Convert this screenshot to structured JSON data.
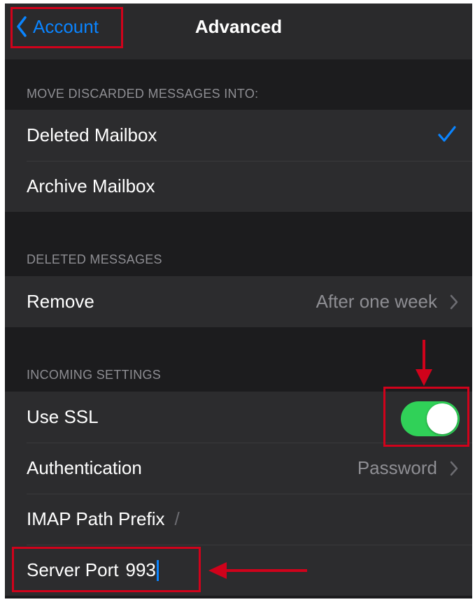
{
  "navbar": {
    "back_label": "Account",
    "title": "Advanced"
  },
  "sections": {
    "discarded": {
      "header": "MOVE DISCARDED MESSAGES INTO:",
      "items": [
        {
          "label": "Deleted Mailbox",
          "selected": true
        },
        {
          "label": "Archive Mailbox",
          "selected": false
        }
      ]
    },
    "deleted": {
      "header": "DELETED MESSAGES",
      "remove": {
        "label": "Remove",
        "value": "After one week"
      }
    },
    "incoming": {
      "header": "INCOMING SETTINGS",
      "use_ssl": {
        "label": "Use SSL",
        "on": true
      },
      "authentication": {
        "label": "Authentication",
        "value": "Password"
      },
      "imap_prefix": {
        "label": "IMAP Path Prefix",
        "value": "/"
      },
      "server_port": {
        "label": "Server Port",
        "value": "993"
      }
    }
  },
  "colors": {
    "accent": "#0a84ff",
    "toggle_on": "#30d158",
    "annotation": "#d0021b"
  },
  "icons": [
    "chevron-left-icon",
    "checkmark-icon",
    "chevron-right-icon",
    "arrow-down-icon",
    "arrow-left-icon"
  ]
}
